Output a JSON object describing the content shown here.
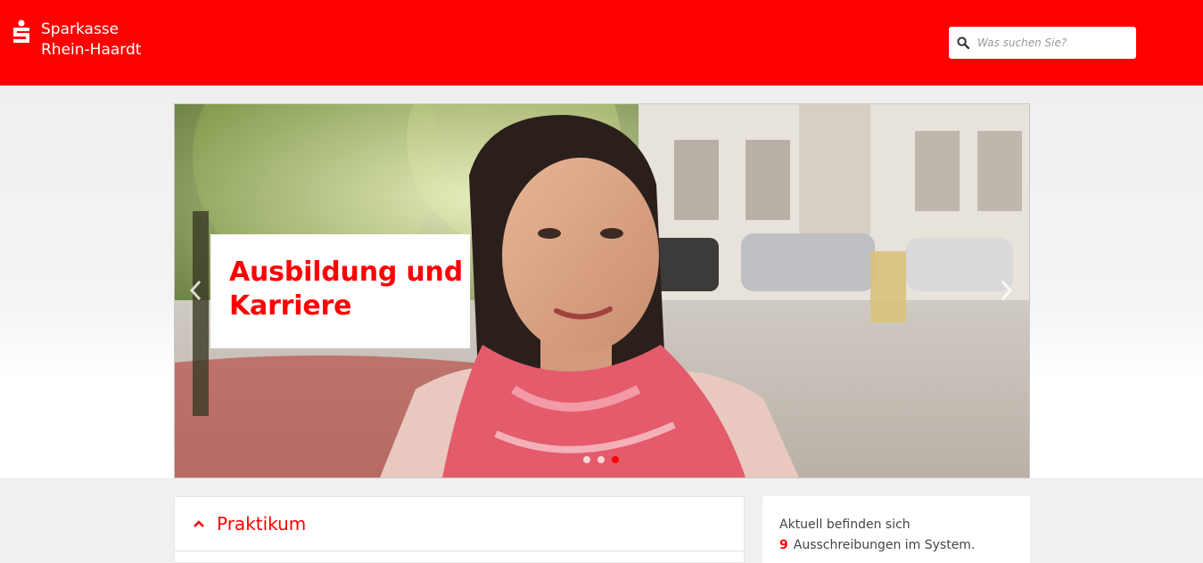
{
  "brand": {
    "line1": "Sparkasse",
    "line2": "Rhein-Haardt",
    "color": "#ff0000"
  },
  "search": {
    "placeholder": "Was suchen Sie?",
    "value": ""
  },
  "hero": {
    "title": "Ausbildung und Karriere",
    "slides_total": 3,
    "active_slide": 3
  },
  "panel": {
    "title": "Praktikum"
  },
  "info": {
    "line1": "Aktuell befinden sich",
    "count": "9",
    "line2": "Ausschreibungen im System."
  },
  "icons": {
    "search": "search-icon",
    "logo": "sparkasse-logo-icon",
    "prev": "chevron-left-icon",
    "next": "chevron-right-icon",
    "collapse": "chevron-up-icon"
  }
}
